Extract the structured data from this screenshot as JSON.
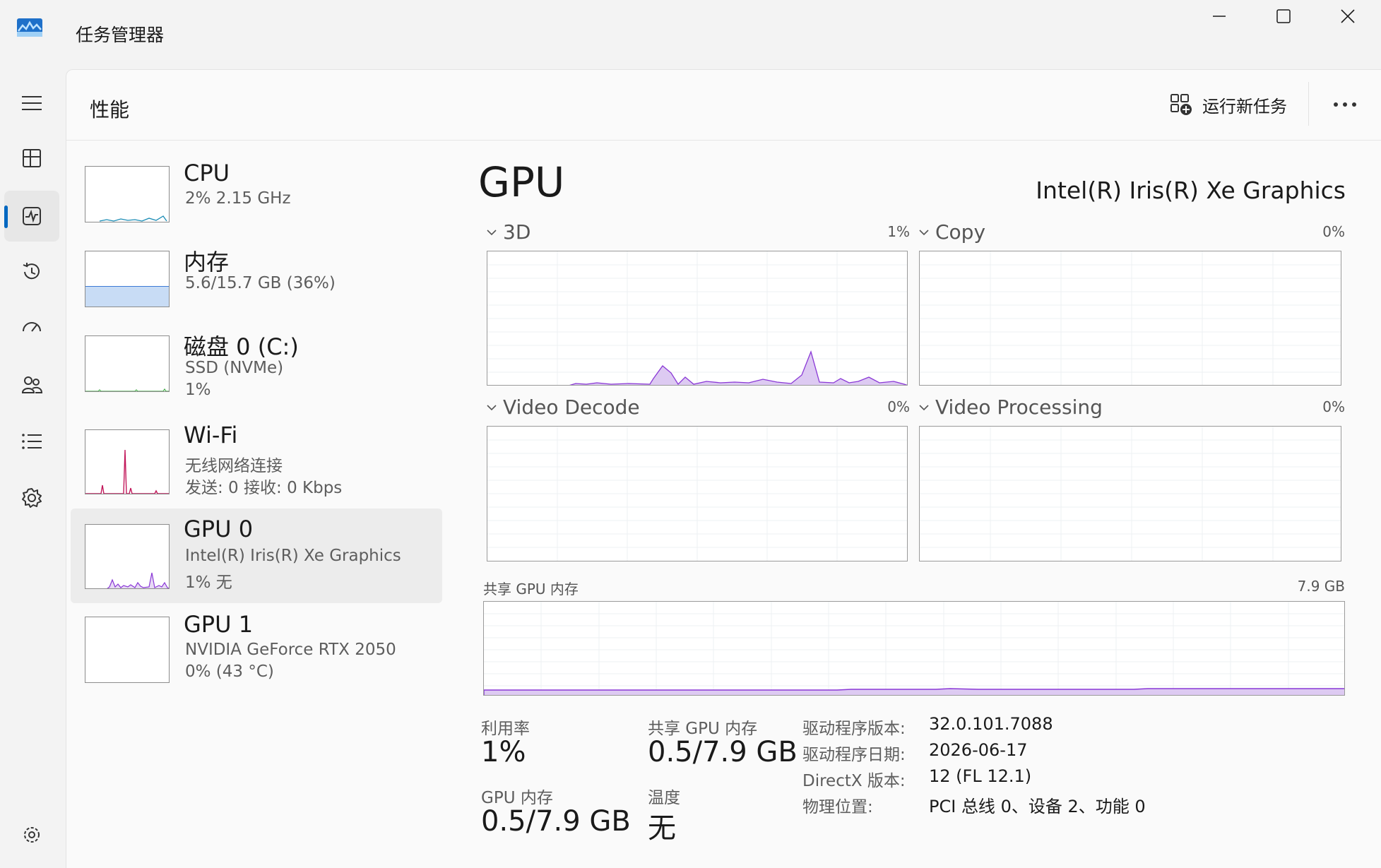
{
  "window": {
    "title": "任务管理器"
  },
  "header": {
    "page_title": "性能",
    "run_task_label": "运行新任务"
  },
  "rail": {
    "items": [
      {
        "name": "menu-icon"
      },
      {
        "name": "processes-icon"
      },
      {
        "name": "performance-icon",
        "active": true
      },
      {
        "name": "app-history-icon"
      },
      {
        "name": "startup-apps-icon"
      },
      {
        "name": "users-icon"
      },
      {
        "name": "details-icon"
      },
      {
        "name": "services-icon"
      },
      {
        "name": "settings-icon"
      }
    ]
  },
  "devices": [
    {
      "name": "CPU",
      "line1": "2%  2.15 GHz",
      "line2": "",
      "color": "#1a8cb5"
    },
    {
      "name": "内存",
      "line1": "5.6/15.7 GB (36%)",
      "line2": "",
      "color": "#3d7ad6",
      "fill": 0.36
    },
    {
      "name": "磁盘 0 (C:)",
      "line1": "SSD (NVMe)",
      "line2": "1%",
      "color": "#4caf50"
    },
    {
      "name": "Wi-Fi",
      "line1": "无线网络连接",
      "line2": "发送: 0  接收: 0 Kbps",
      "color": "#c2185b"
    },
    {
      "name": "GPU 0",
      "line1": "Intel(R) Iris(R) Xe Graphics",
      "line2": "1%  无",
      "color": "#8a38d6",
      "selected": true
    },
    {
      "name": "GPU 1",
      "line1": "NVIDIA GeForce RTX 2050",
      "line2": "0%  (43 °C)",
      "color": "#8a38d6"
    }
  ],
  "detail": {
    "title": "GPU",
    "gpu_name": "Intel(R) Iris(R) Xe Graphics",
    "engines": [
      {
        "label": "3D",
        "pct": "1%"
      },
      {
        "label": "Copy",
        "pct": "0%"
      },
      {
        "label": "Video Decode",
        "pct": "0%"
      },
      {
        "label": "Video Processing",
        "pct": "0%"
      }
    ],
    "shared_mem": {
      "label": "共享 GPU 内存",
      "max": "7.9 GB"
    },
    "stats": {
      "util_label": "利用率",
      "util_value": "1%",
      "shared_label": "共享 GPU 内存",
      "shared_value": "0.5/7.9 GB",
      "gpumem_label": "GPU 内存",
      "gpumem_value": "0.5/7.9 GB",
      "temp_label": "温度",
      "temp_value": "无"
    },
    "info": [
      {
        "k": "驱动程序版本:",
        "v": "32.0.101.7088"
      },
      {
        "k": "驱动程序日期:",
        "v": "2026-06-17"
      },
      {
        "k": "DirectX 版本:",
        "v": "12 (FL 12.1)"
      },
      {
        "k": "物理位置:",
        "v": "PCI 总线 0、设备 2、功能 0"
      }
    ]
  },
  "colors": {
    "accent": "#0067c0",
    "gpu_line": "#8a38d6",
    "gpu_fill": "#d9c3f0"
  }
}
